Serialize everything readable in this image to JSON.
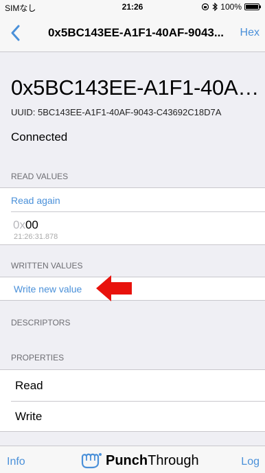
{
  "status_bar": {
    "carrier": "SIMなし",
    "time": "21:26",
    "battery": "100%"
  },
  "nav": {
    "title": "0x5BC143EE-A1F1-40AF-9043...",
    "right_button": "Hex"
  },
  "characteristic": {
    "name": "0x5BC143EE-A1F1-40AF...",
    "uuid": "UUID: 5BC143EE-A1F1-40AF-9043-C43692C18D7A",
    "status": "Connected"
  },
  "read_values": {
    "header": "READ VALUES",
    "action": "Read again",
    "value_prefix": "0x",
    "value": "00",
    "timestamp": "21:26:31.878"
  },
  "written_values": {
    "header": "WRITTEN VALUES",
    "action": "Write new value"
  },
  "descriptors": {
    "header": "DESCRIPTORS"
  },
  "properties": {
    "header": "PROPERTIES",
    "items": [
      "Read",
      "Write"
    ]
  },
  "tab_bar": {
    "left": "Info",
    "brand_bold": "Punch",
    "brand_regular": "Through",
    "right": "Log"
  },
  "colors": {
    "accent": "#4a90d9",
    "arrow": "#e8120c",
    "background": "#efeff4"
  }
}
